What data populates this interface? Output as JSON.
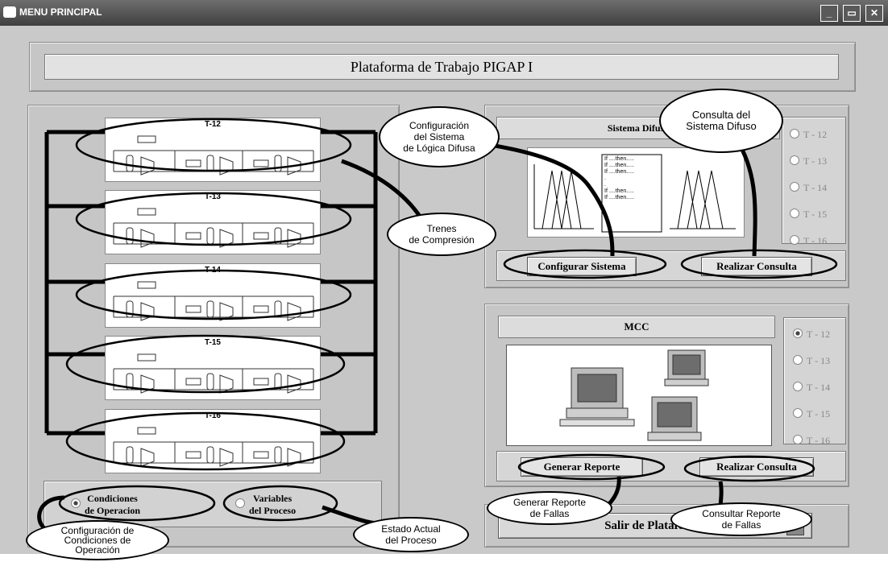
{
  "window": {
    "title": "MENU PRINCIPAL",
    "controls": [
      "_",
      "▭",
      "✕"
    ]
  },
  "header": {
    "title": "Plataforma de Trabajo PIGAP I"
  },
  "left_panel": {
    "trains": [
      "T-12",
      "T-13",
      "T-14",
      "T-15",
      "T-16"
    ],
    "options": [
      {
        "label": "Condiciones\nde Operacion",
        "selected": true
      },
      {
        "label": "Variables\ndel Proceso",
        "selected": false
      }
    ]
  },
  "fuzzy_panel": {
    "title": "Sistema Difuso",
    "rules": "If ....then.....\nIf ....then.....\nIf ....then.....\n.\n.\nIf ....then.....\nIf ....then.....",
    "configure_button": "Configurar Sistema",
    "query_button": "Realizar Consulta",
    "radios": [
      "T - 12",
      "T - 13",
      "T - 14",
      "T - 15",
      "T - 16"
    ]
  },
  "mcc_panel": {
    "title": "MCC",
    "report_button": "Generar Reporte",
    "query_button": "Realizar Consulta",
    "radios": [
      "T - 12",
      "T - 13",
      "T - 14",
      "T - 15",
      "T - 16"
    ],
    "selected": "T - 12"
  },
  "exit_button": "Salir de Plataforma",
  "callouts": {
    "config_fuzzy": "Configuración\ndel Sistema\nde Lógica Difusa",
    "query_fuzzy": "Consulta del\nSistema Difuso",
    "trains": "Trenes\nde Compresión",
    "report": "Generar Reporte\nde Fallas",
    "query_report": "Consultar Reporte\nde Fallas",
    "state": "Estado Actual\ndel Proceso",
    "conditions": "Configuración de\nCondiciones de\nOperación"
  }
}
